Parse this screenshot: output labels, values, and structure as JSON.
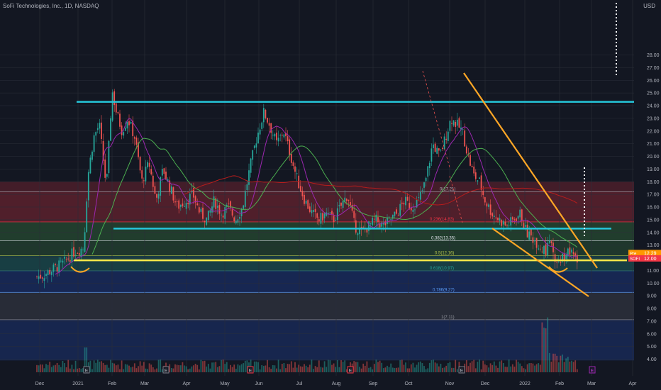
{
  "header": {
    "symbol": "SoFi Technologies, Inc., 1D, NASDAQ",
    "currency": "USD"
  },
  "chart_data": {
    "type": "candlestick",
    "y_ticks": [
      "4.00",
      "5.00",
      "6.00",
      "7.00",
      "8.00",
      "9.00",
      "10.00",
      "11.00",
      "12.00",
      "13.00",
      "14.00",
      "15.00",
      "16.00",
      "17.00",
      "18.00",
      "19.00",
      "20.00",
      "21.00",
      "22.00",
      "23.00",
      "24.00",
      "25.00",
      "26.00",
      "27.00",
      "28.00"
    ],
    "x_labels": [
      "Dec",
      "2021",
      "Feb",
      "Mar",
      "Apr",
      "May",
      "Jun",
      "Jul",
      "Aug",
      "Sep",
      "Oct",
      "Nov",
      "Dec",
      "2022",
      "Feb",
      "Mar",
      "Apr"
    ],
    "fib_levels": [
      {
        "label": "0(17.21)",
        "value": 17.21,
        "color": "#b2b5be"
      },
      {
        "label": "0.236(14.83)",
        "value": 14.83,
        "color": "#f23645"
      },
      {
        "label": "0.382(13.35)",
        "value": 13.35,
        "color": "#e0e3eb"
      },
      {
        "label": "0.5(12.16)",
        "value": 12.16,
        "color": "#b7c94e"
      },
      {
        "label": "0.618(10.97)",
        "value": 10.97,
        "color": "#26a69a"
      },
      {
        "label": "0.786(9.27)",
        "value": 9.27,
        "color": "#5b9cf6"
      },
      {
        "label": "1(7.11)",
        "value": 7.11,
        "color": "#9598a1"
      }
    ],
    "price_tags": [
      {
        "label": "Pre",
        "value": "12.29",
        "color": "#ff9800"
      },
      {
        "label": "SOFI",
        "value": "12.00",
        "color": "#f23645"
      }
    ],
    "earnings_markers": [
      "E",
      "E",
      "E",
      "E",
      "E",
      "E"
    ],
    "levels": {
      "resistance": 24.3,
      "support_mid": 14.3,
      "support_low": 11.8
    }
  }
}
